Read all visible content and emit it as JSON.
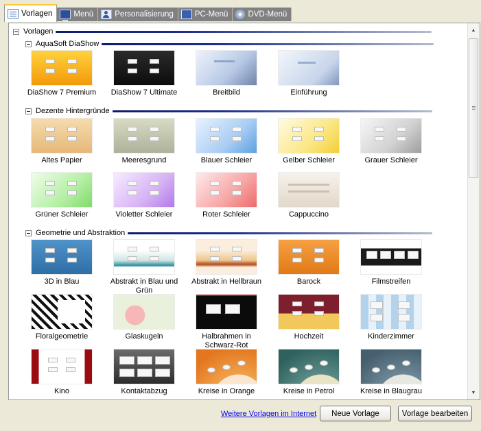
{
  "tabs": [
    {
      "label": "Vorlagen",
      "icon": "template-list-icon"
    },
    {
      "label": "Menü",
      "icon": "screen-icon"
    },
    {
      "label": "Personalisierung",
      "icon": "personalize-icon"
    },
    {
      "label": "PC-Menü",
      "icon": "pc-icon"
    },
    {
      "label": "DVD-Menü",
      "icon": "dvd-icon"
    }
  ],
  "active_tab": "Vorlagen",
  "tree": {
    "root_label": "Vorlagen",
    "sections": [
      {
        "label": "AquaSoft DiaShow",
        "items": [
          "DiaShow 7 Premium",
          "DiaShow 7 Ultimate",
          "Breitbild",
          "Einführung"
        ]
      },
      {
        "label": "Dezente Hintergründe",
        "items": [
          "Altes Papier",
          "Meeresgrund",
          "Blauer Schleier",
          "Gelber Schleier",
          "Grauer Schleier",
          "Grüner Schleier",
          "Violetter Schleier",
          "Roter Schleier",
          "Cappuccino"
        ]
      },
      {
        "label": "Geometrie und Abstraktion",
        "items": [
          "3D in Blau",
          "Abstrakt in Blau und Grün",
          "Abstrakt in Hellbraun",
          "Barock",
          "Filmstreifen",
          "Floralgeometrie",
          "Glaskugeln",
          "Halbrahmen in Schwarz-Rot",
          "Hochzeit",
          "Kinderzimmer",
          "Kino",
          "Kontaktabzug",
          "Kreise in Orange",
          "Kreise in Petrol",
          "Kreise in Blaugrau"
        ]
      }
    ]
  },
  "footer": {
    "link": "Weitere Vorlagen im Internet",
    "new_button": "Neue Vorlage",
    "edit_button": "Vorlage bearbeiten"
  }
}
